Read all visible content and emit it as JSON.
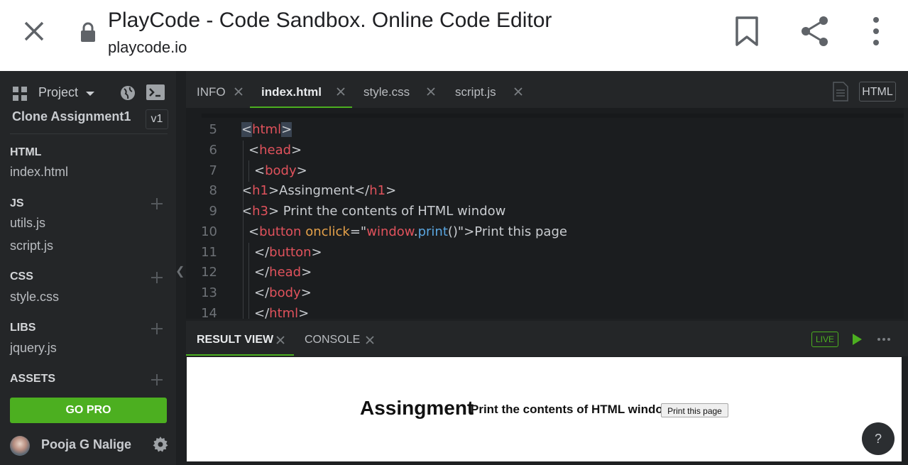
{
  "browser": {
    "title": "PlayCode - Code Sandbox. Online Code Editor",
    "url": "playcode.io"
  },
  "sidebar": {
    "project_label": "Project",
    "project_name": "Clone Assignment1",
    "version": "v1",
    "sections": [
      {
        "title": "HTML",
        "files": [
          "index.html"
        ]
      },
      {
        "title": "JS",
        "files": [
          "utils.js",
          "script.js"
        ]
      },
      {
        "title": "CSS",
        "files": [
          "style.css"
        ]
      },
      {
        "title": "LIBS",
        "files": [
          "jquery.js"
        ]
      },
      {
        "title": "ASSETS",
        "files": []
      }
    ],
    "go_pro": "GO PRO",
    "user_name": "Pooja G Nalige"
  },
  "editor_tabs": [
    "INFO",
    "index.html",
    "style.css",
    "script.js"
  ],
  "active_tab": "index.html",
  "language_badge": "HTML",
  "code_lines": [
    {
      "n": "5",
      "t": "<html>"
    },
    {
      "n": "6",
      "t": "<head>"
    },
    {
      "n": "7",
      "t": "<body>"
    },
    {
      "n": "8",
      "t": "<h1>Assingment</h1>"
    },
    {
      "n": "9",
      "t": "<h3> Print the contents of HTML window"
    },
    {
      "n": "10",
      "t": "<button onclick=\"window.print()\">Print this page"
    },
    {
      "n": "11",
      "t": "</button>"
    },
    {
      "n": "12",
      "t": "</head>"
    },
    {
      "n": "13",
      "t": "</body>"
    },
    {
      "n": "14",
      "t": "</html>"
    }
  ],
  "panel_tabs": [
    "RESULT VIEW",
    "CONSOLE"
  ],
  "live_label": "LIVE",
  "result": {
    "h1": "Assingment",
    "h3": "Print the contents of HTML window",
    "button": "Print this page"
  },
  "help_label": "?",
  "colors": {
    "accent": "#4caf20",
    "tag": "#e0525c",
    "attr": "#e5a14a",
    "fn": "#5aa6e0"
  }
}
